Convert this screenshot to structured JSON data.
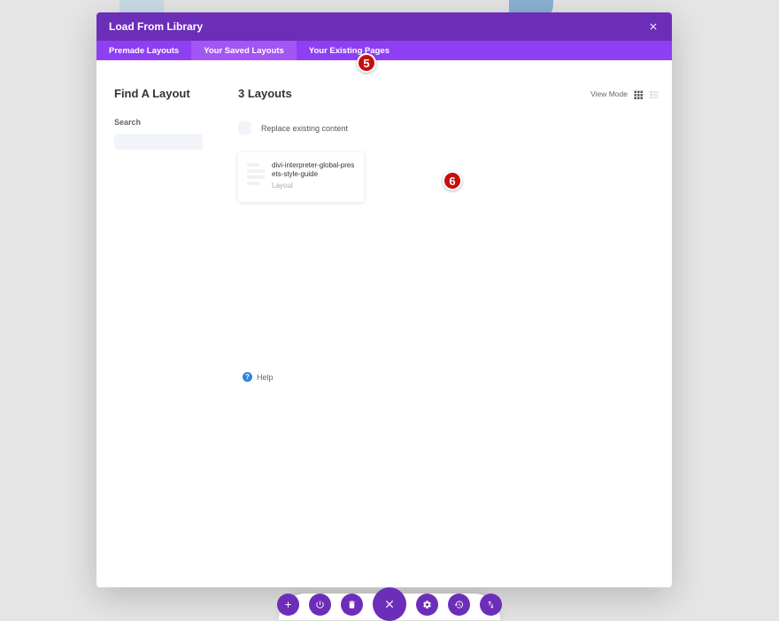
{
  "modal": {
    "title": "Load From Library",
    "tabs": [
      {
        "label": "Premade Layouts"
      },
      {
        "label": "Your Saved Layouts"
      },
      {
        "label": "Your Existing Pages"
      }
    ]
  },
  "sidebar": {
    "heading": "Find A Layout",
    "search_label": "Search",
    "search_value": ""
  },
  "main": {
    "heading": "3 Layouts",
    "view_mode_label": "View Mode",
    "replace_label": "Replace existing content",
    "layouts": [
      {
        "title": "divi-interpreter-global-presets-style-guide",
        "type": "Layout"
      }
    ]
  },
  "help": {
    "label": "Help",
    "icon_glyph": "?"
  },
  "annotations": {
    "a5": "5",
    "a6": "6"
  }
}
